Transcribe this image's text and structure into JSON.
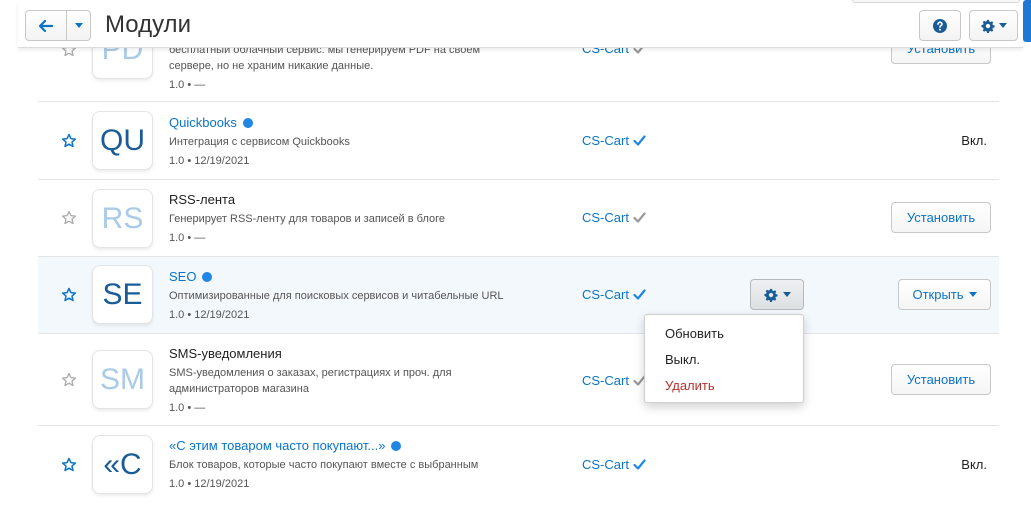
{
  "header": {
    "title": "Модули"
  },
  "colors": {
    "accent": "#0b74c8",
    "verified": "#1f86e5",
    "danger": "#b2312b",
    "row_highlight": "#f3f8fd"
  },
  "rows": [
    {
      "name": "",
      "logo": "PD",
      "enabled": false,
      "description": "бесплатный облачный сервис. мы генерируем PDF на своем сервере, но не храним никакие данные.",
      "meta": "1.0 • —",
      "developer": "CS-Cart",
      "action": "Установить"
    },
    {
      "name": "Quickbooks",
      "logo": "QU",
      "enabled": true,
      "description": "Интеграция с сервисом Quickbooks",
      "meta": "1.0 • 12/19/2021",
      "developer": "CS-Cart",
      "status": "Вкл."
    },
    {
      "name": "RSS-лента",
      "logo": "RS",
      "enabled": false,
      "description": "Генерирует RSS-ленту для товаров и записей в блоге",
      "meta": "1.0 • —",
      "developer": "CS-Cart",
      "action": "Установить"
    },
    {
      "name": "SEO",
      "logo": "SE",
      "enabled": true,
      "description": "Оптимизированные для поисковых сервисов и читабельные URL",
      "meta": "1.0 • 12/19/2021",
      "developer": "CS-Cart",
      "action": "Открыть"
    },
    {
      "name": "SMS-уведомления",
      "logo": "SM",
      "enabled": false,
      "description": "SMS-уведомления о заказах, регистрациях и проч. для администраторов магазина",
      "meta": "1.0 • —",
      "developer": "CS-Cart",
      "action": "Установить"
    },
    {
      "name": "«С этим товаром часто покупают...»",
      "logo": "«C",
      "enabled": true,
      "description": "Блок товаров, которые часто покупают вместе с выбранным",
      "meta": "1.0 • 12/19/2021",
      "developer": "CS-Cart",
      "status": "Вкл."
    }
  ],
  "dropdown": {
    "items": [
      "Обновить",
      "Выкл.",
      "Удалить"
    ]
  }
}
